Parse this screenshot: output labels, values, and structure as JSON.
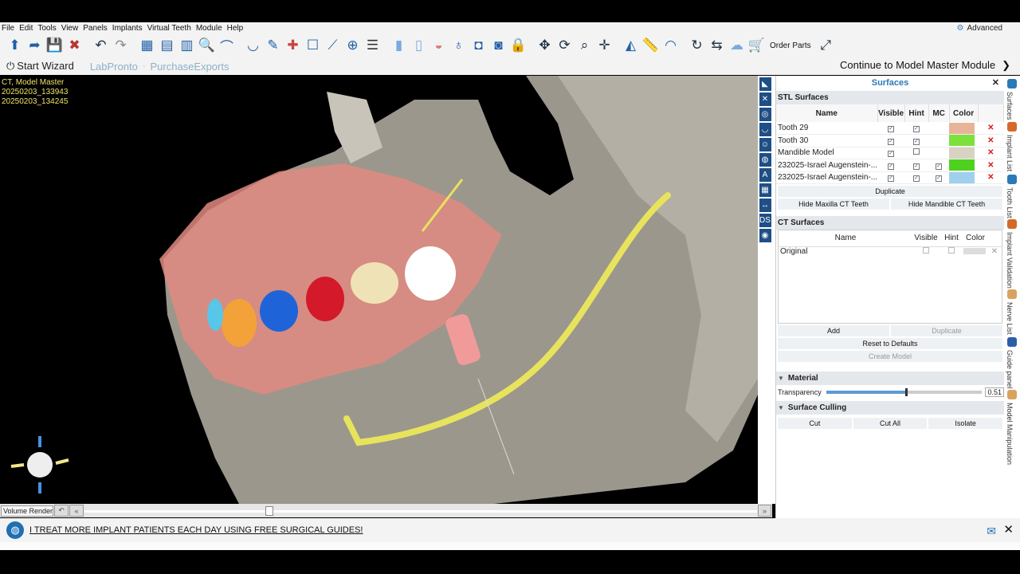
{
  "menu": {
    "items": [
      "File",
      "Edit",
      "Tools",
      "View",
      "Panels",
      "Implants",
      "Virtual Teeth",
      "Module",
      "Help"
    ],
    "mode": "Advanced"
  },
  "toolbar": {
    "order_parts": "Order Parts"
  },
  "wizard": {
    "start": "Start Wizard",
    "labpronto": "LabPronto",
    "separator": "·",
    "purchase_exports": "PurchaseExports",
    "continue": "Continue to Model Master Module"
  },
  "viewport": {
    "line1": "CT, Model Master",
    "line2": "20250203_133943",
    "line3": "20250203_134245",
    "render_mode": "Volume Renderin"
  },
  "panel": {
    "title": "Surfaces",
    "stl": {
      "title": "STL Surfaces",
      "headers": [
        "Name",
        "Visible",
        "Hint",
        "MC",
        "Color"
      ],
      "rows": [
        {
          "name": "Tooth 29",
          "visible": "✓",
          "hint": "✓",
          "mc": "",
          "color": "#e7b49a"
        },
        {
          "name": "Tooth 30",
          "visible": "✓",
          "hint": "✓",
          "mc": "",
          "color": "#7de03c"
        },
        {
          "name": "Mandible Model",
          "visible": "✓",
          "hint": "",
          "mc": "",
          "color": "#d8d2c2"
        },
        {
          "name": "232025-Israel Augenstein-...",
          "visible": "✓",
          "hint": "✓",
          "mc": "✓",
          "color": "#4ed21e"
        },
        {
          "name": "232025-Israel Augenstein-...",
          "visible": "✓",
          "hint": "✓",
          "mc": "✓",
          "color": "#9fd1ee"
        }
      ],
      "duplicate": "Duplicate",
      "hide_maxilla": "Hide Maxilla CT Teeth",
      "hide_mandible": "Hide Mandible CT Teeth"
    },
    "ct": {
      "title": "CT Surfaces",
      "headers": [
        "Name",
        "Visible",
        "Hint",
        "Color"
      ],
      "rows": [
        {
          "name": "Original"
        }
      ],
      "add": "Add",
      "duplicate": "Duplicate",
      "reset": "Reset to Defaults",
      "create": "Create Model"
    },
    "material": {
      "title": "Material",
      "transparency_label": "Transparency",
      "transparency": 0.51,
      "transparency_text": "0.51"
    },
    "culling": {
      "title": "Surface Culling",
      "cut": "Cut",
      "cut_all": "Cut All",
      "isolate": "Isolate"
    }
  },
  "side_tabs": [
    "Surfaces",
    "Implant List",
    "Tooth List",
    "Implant Validation",
    "Nerve List",
    "Guide panel",
    "Model Manipulation"
  ],
  "ad": {
    "text": "I TREAT MORE IMPLANT PATIENTS EACH DAY USING FREE SURGICAL GUIDES!"
  }
}
